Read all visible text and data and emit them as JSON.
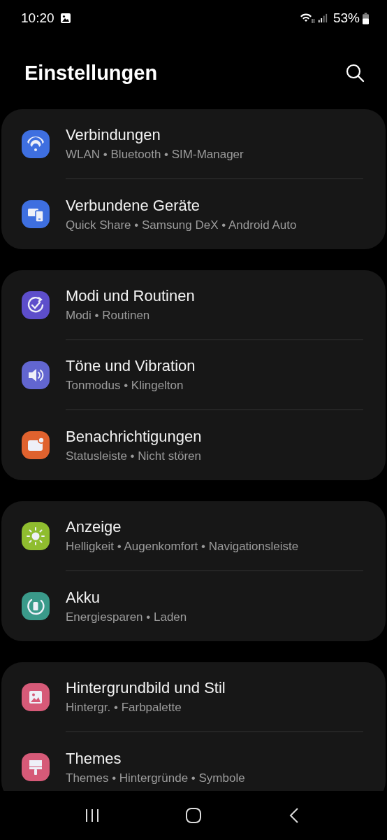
{
  "status_bar": {
    "time": "10:20",
    "battery": "53%"
  },
  "header": {
    "title": "Einstellungen"
  },
  "groups": [
    {
      "items": [
        {
          "title": "Verbindungen",
          "subtitle": "WLAN • Bluetooth • SIM-Manager",
          "color": "#3e6fe0"
        },
        {
          "title": "Verbundene Geräte",
          "subtitle": "Quick Share • Samsung DeX • Android Auto",
          "color": "#3e6fe0"
        }
      ]
    },
    {
      "items": [
        {
          "title": "Modi und Routinen",
          "subtitle": "Modi • Routinen",
          "color": "#5d4ecb"
        },
        {
          "title": "Töne und Vibration",
          "subtitle": "Tonmodus • Klingelton",
          "color": "#6266d0"
        },
        {
          "title": "Benachrichtigungen",
          "subtitle": "Statusleiste • Nicht stören",
          "color": "#e0622e"
        }
      ]
    },
    {
      "items": [
        {
          "title": "Anzeige",
          "subtitle": "Helligkeit • Augenkomfort • Navigationsleiste",
          "color": "#8fbd2f"
        },
        {
          "title": "Akku",
          "subtitle": "Energiesparen • Laden",
          "color": "#3a9a8a"
        }
      ]
    },
    {
      "items": [
        {
          "title": "Hintergrundbild und Stil",
          "subtitle": "Hintergr. • Farbpalette",
          "color": "#d65a78"
        },
        {
          "title": "Themes",
          "subtitle": "Themes • Hintergründe • Symbole",
          "color": "#d65a78"
        }
      ]
    }
  ]
}
